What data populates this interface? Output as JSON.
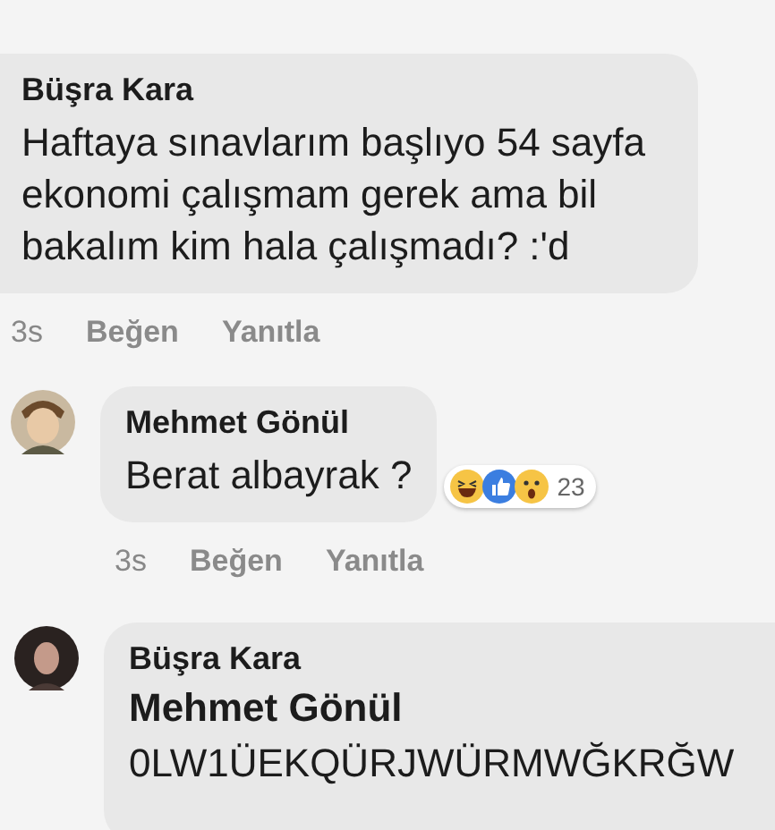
{
  "comments": [
    {
      "kind": "top",
      "author": "Büşra Kara",
      "text": "Haftaya sınavlarım başlıyo 54 sayfa ekonomi çalışmam gerek ama bil bakalım kim hala çalışmadı? :'d",
      "time": "3s",
      "actions": [
        "Beğen",
        "Yanıtla"
      ]
    },
    {
      "kind": "reply",
      "author": "Mehmet Gönül",
      "text": "Berat albayrak ?",
      "reactions": {
        "count": "23"
      },
      "time": "3s",
      "actions": [
        "Beğen",
        "Yanıtla"
      ]
    },
    {
      "kind": "reply",
      "author": "Büşra Kara",
      "mention": "Mehmet Gönül",
      "text": "0LW1ÜEKQÜRJWÜRMWĞKRĞW"
    }
  ]
}
